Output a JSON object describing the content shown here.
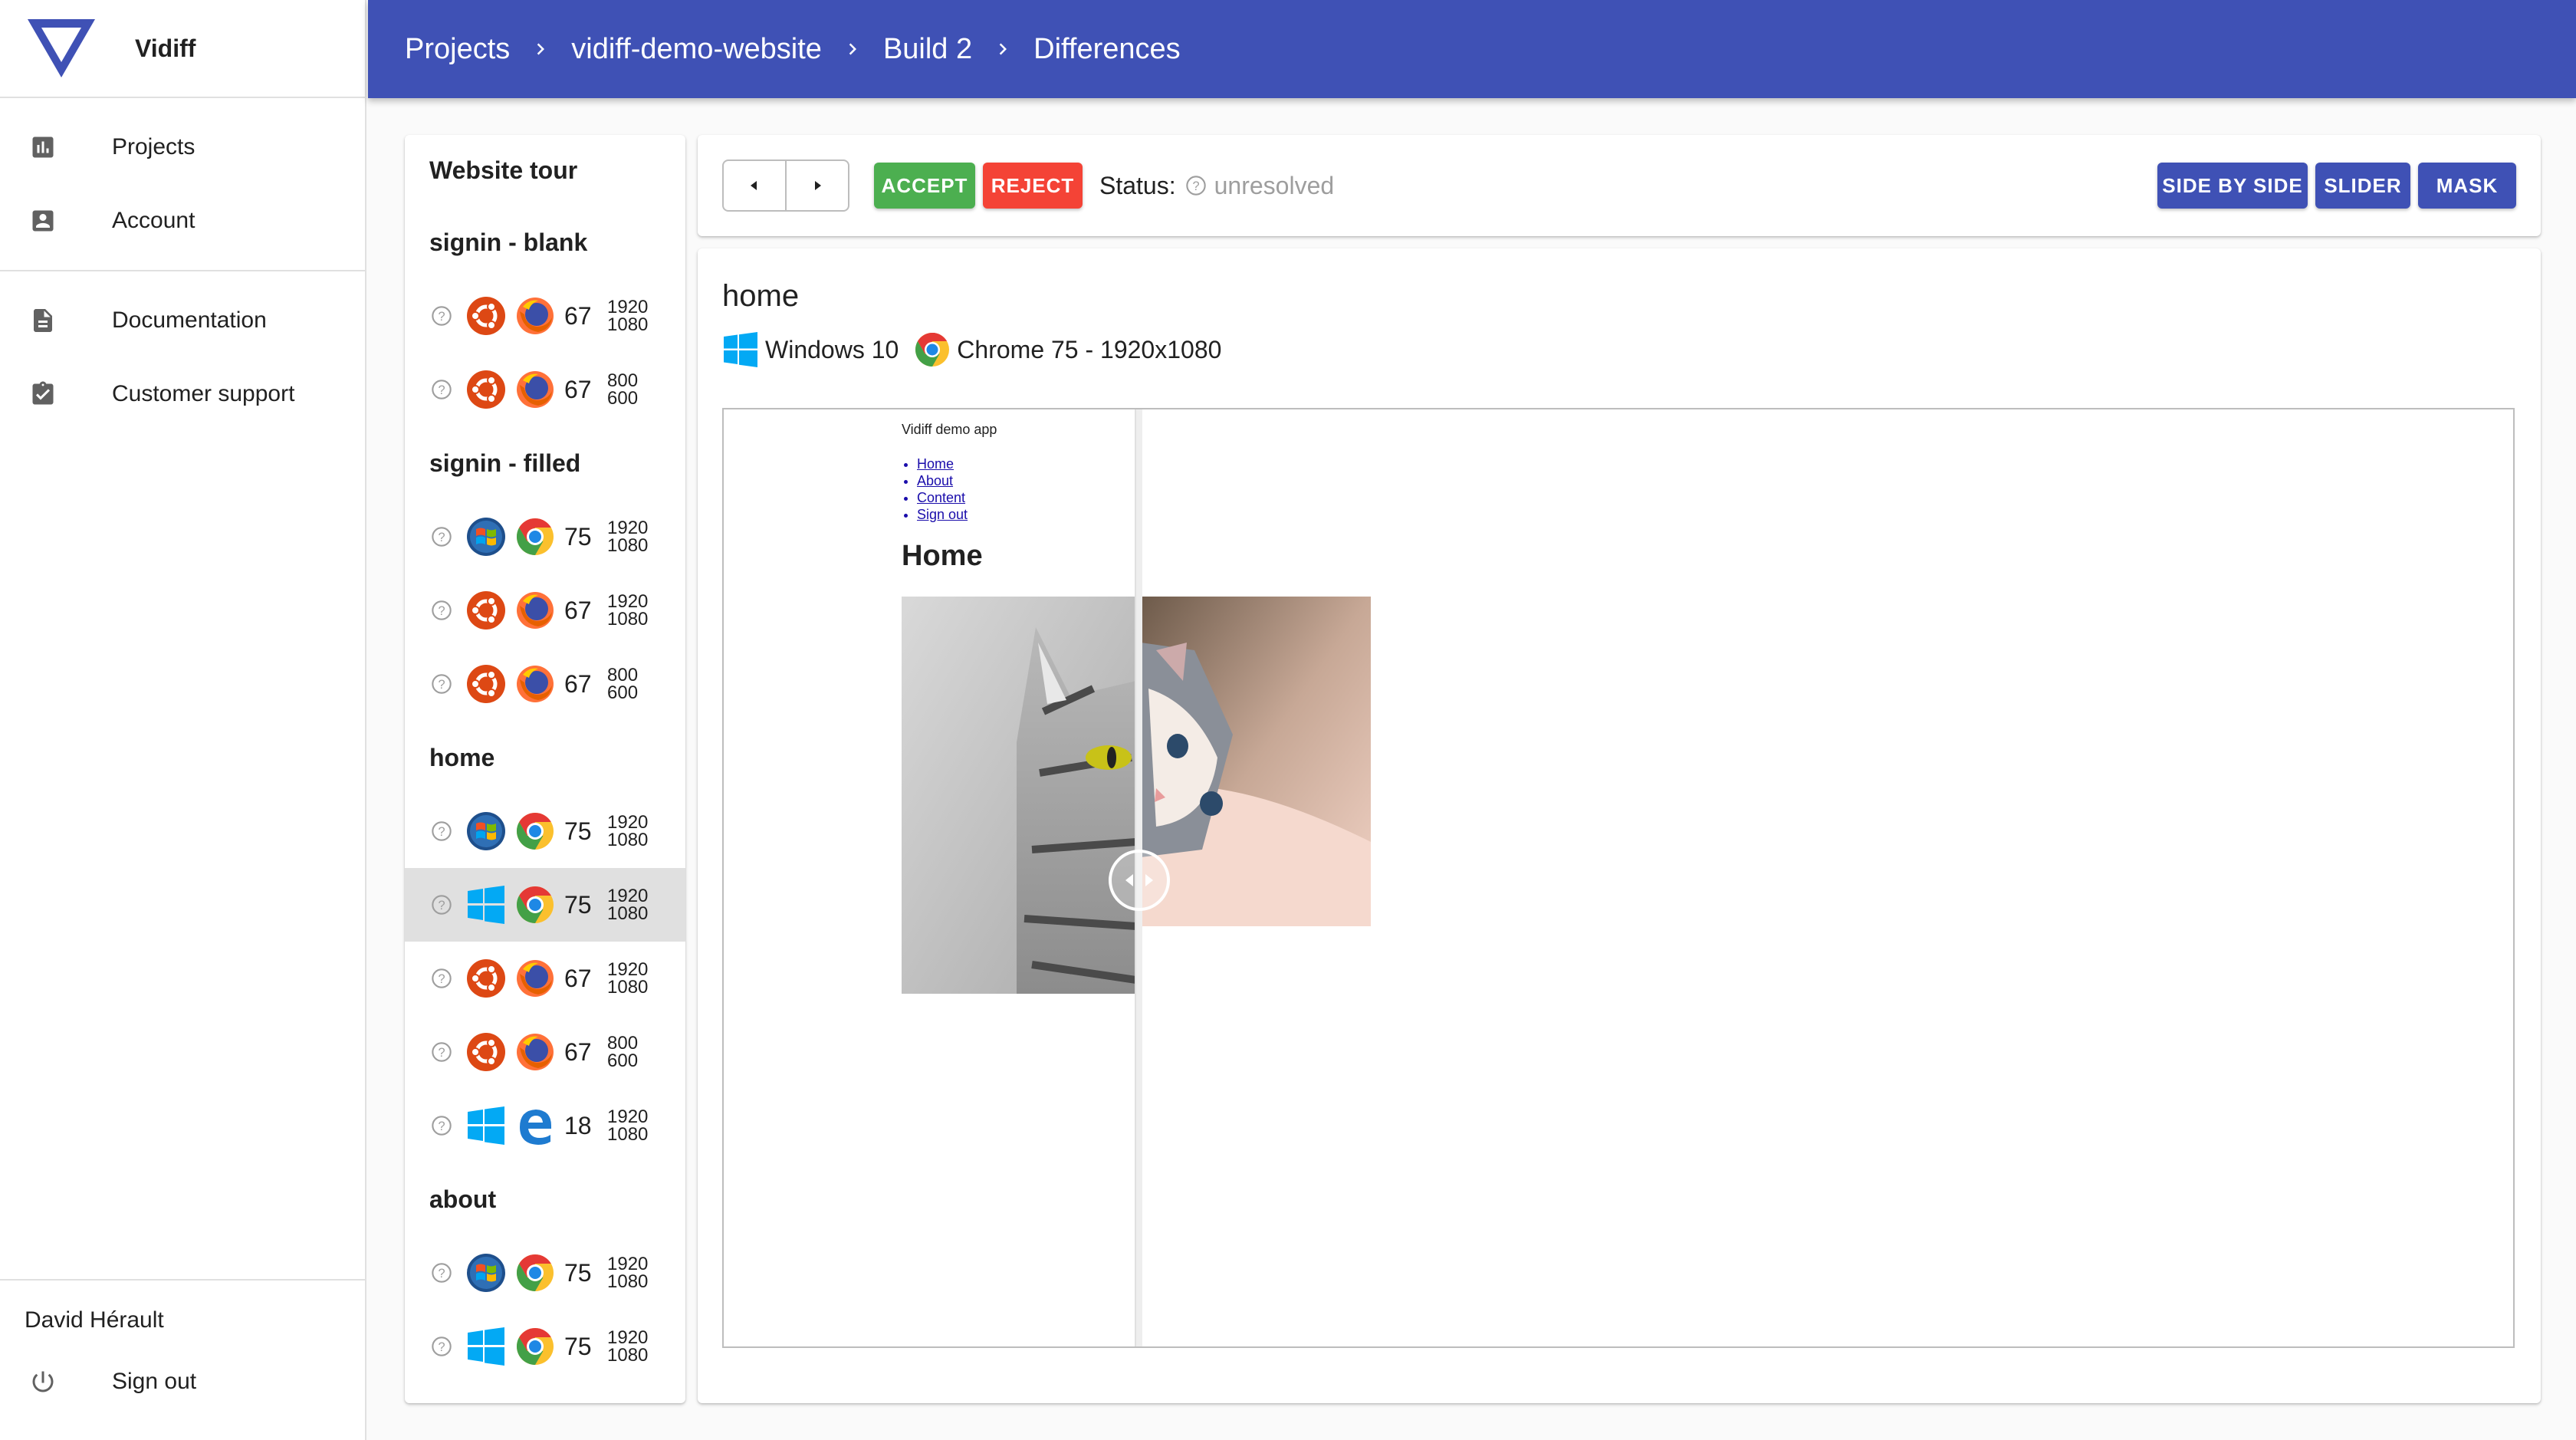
{
  "app": {
    "name": "Vidiff"
  },
  "drawer": {
    "main_items": [
      {
        "label": "Projects",
        "icon": "bar-chart-icon"
      },
      {
        "label": "Account",
        "icon": "account-box-icon"
      }
    ],
    "help_items": [
      {
        "label": "Documentation",
        "icon": "document-icon"
      },
      {
        "label": "Customer support",
        "icon": "assignment-check-icon"
      }
    ],
    "user": "David Hérault",
    "signout_label": "Sign out"
  },
  "breadcrumb": [
    "Projects",
    "vidiff-demo-website",
    "Build 2",
    "Differences"
  ],
  "list": {
    "title": "Website tour",
    "sections": [
      {
        "name": "signin - blank",
        "rows": [
          {
            "os": "ubuntu",
            "browser": "firefox",
            "version": "67",
            "res_w": "1920",
            "res_h": "1080"
          },
          {
            "os": "ubuntu",
            "browser": "firefox",
            "version": "67",
            "res_w": "800",
            "res_h": "600"
          }
        ]
      },
      {
        "name": "signin - filled",
        "rows": [
          {
            "os": "windows-7",
            "browser": "chrome",
            "version": "75",
            "res_w": "1920",
            "res_h": "1080"
          },
          {
            "os": "ubuntu",
            "browser": "firefox",
            "version": "67",
            "res_w": "1920",
            "res_h": "1080"
          },
          {
            "os": "ubuntu",
            "browser": "firefox",
            "version": "67",
            "res_w": "800",
            "res_h": "600"
          }
        ]
      },
      {
        "name": "home",
        "rows": [
          {
            "os": "windows-7",
            "browser": "chrome",
            "version": "75",
            "res_w": "1920",
            "res_h": "1080"
          },
          {
            "os": "windows-10",
            "browser": "chrome",
            "version": "75",
            "res_w": "1920",
            "res_h": "1080",
            "selected": true
          },
          {
            "os": "ubuntu",
            "browser": "firefox",
            "version": "67",
            "res_w": "1920",
            "res_h": "1080"
          },
          {
            "os": "ubuntu",
            "browser": "firefox",
            "version": "67",
            "res_w": "800",
            "res_h": "600"
          },
          {
            "os": "windows-10",
            "browser": "edge",
            "version": "18",
            "res_w": "1920",
            "res_h": "1080"
          }
        ]
      },
      {
        "name": "about",
        "rows": [
          {
            "os": "windows-7",
            "browser": "chrome",
            "version": "75",
            "res_w": "1920",
            "res_h": "1080"
          },
          {
            "os": "windows-10",
            "browser": "chrome",
            "version": "75",
            "res_w": "1920",
            "res_h": "1080"
          }
        ]
      }
    ]
  },
  "toolbar": {
    "accept": "ACCEPT",
    "reject": "REJECT",
    "status_label": "Status:",
    "status_value": "unresolved",
    "mode_side_by_side": "SIDE BY SIDE",
    "mode_slider": "SLIDER",
    "mode_mask": "MASK"
  },
  "viewer": {
    "test_name": "home",
    "os": "Windows 10",
    "browser": "Chrome 75 - 1920x1080",
    "page": {
      "title": "Vidiff demo app",
      "nav": [
        "Home",
        "About",
        "Content",
        "Sign out"
      ],
      "heading": "Home"
    }
  },
  "colors": {
    "primary": "#3f51b5",
    "accept": "#4caf50",
    "reject": "#f44336",
    "selected_row": "#e0e0e0"
  }
}
